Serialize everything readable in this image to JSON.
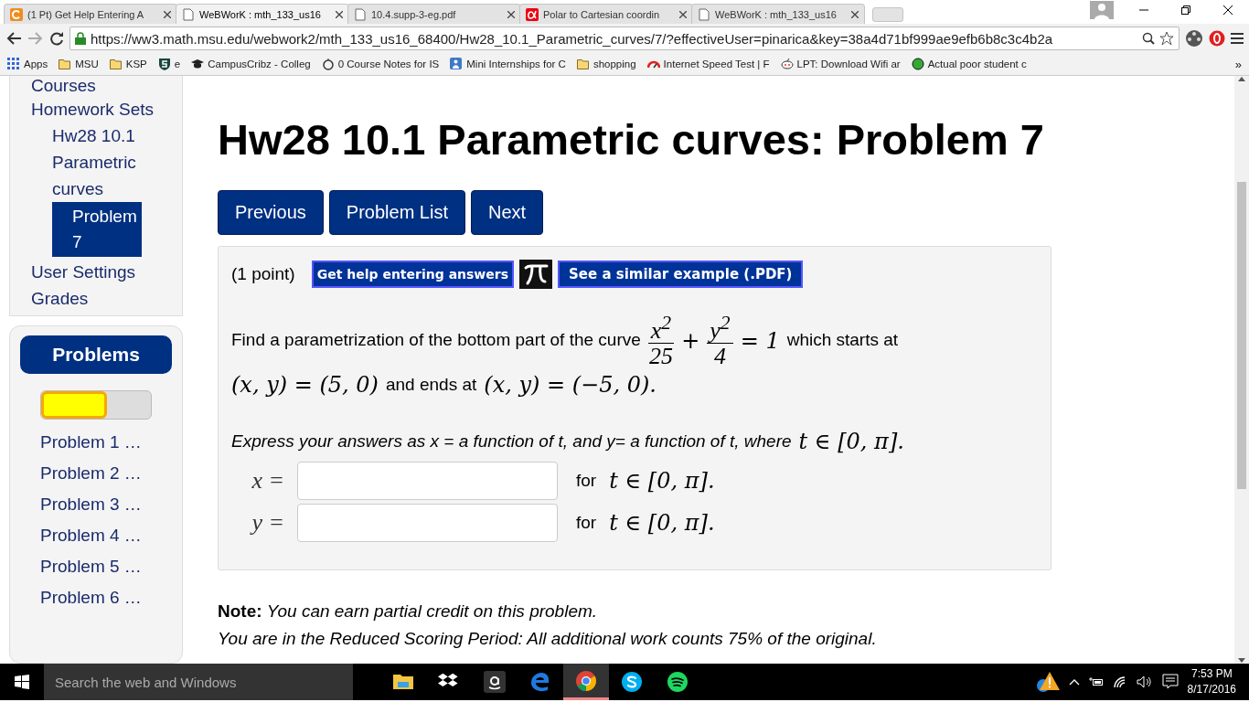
{
  "browser": {
    "tabs": [
      {
        "title": "(1 Pt) Get Help Entering A",
        "selected": false
      },
      {
        "title": "WeBWorK : mth_133_us16",
        "selected": true
      },
      {
        "title": "10.4.supp-3-eg.pdf",
        "selected": false
      },
      {
        "title": "Polar to Cartesian coordin",
        "selected": false
      },
      {
        "title": "WeBWorK : mth_133_us16",
        "selected": false
      }
    ],
    "url": "https://ww3.math.msu.edu/webwork2/mth_133_us16_68400/Hw28_10.1_Parametric_curves/7/?effectiveUser=pinarica&key=38a4d71bf999ae9efb6b8c3c4b2a",
    "bookmarks": [
      {
        "label": "Apps"
      },
      {
        "label": "MSU"
      },
      {
        "label": "KSP"
      },
      {
        "label": "e"
      },
      {
        "label": "CampusCribz - Colleg"
      },
      {
        "label": "0 Course Notes for IS"
      },
      {
        "label": "Mini Internships for C"
      },
      {
        "label": "shopping"
      },
      {
        "label": "Internet Speed Test | F"
      },
      {
        "label": "LPT: Download Wifi ar"
      },
      {
        "label": "Actual poor student c"
      }
    ],
    "more": "»"
  },
  "sidebar": {
    "nav": [
      {
        "label": "Courses"
      },
      {
        "label": "Homework Sets",
        "children": [
          {
            "label": "Hw28 10.1 Parametric curves",
            "selected": false,
            "children": [
              {
                "label": "Problem 7",
                "selected": true
              }
            ]
          }
        ]
      },
      {
        "label": "User Settings"
      },
      {
        "label": "Grades"
      }
    ],
    "problems_title": "Problems",
    "progress": {
      "level": 0.6
    },
    "problems": [
      "Problem 1 …",
      "Problem 2 …",
      "Problem 3 …",
      "Problem 4 …",
      "Problem 5 …",
      "Problem 6 …"
    ]
  },
  "main": {
    "title": "Hw28 10.1 Parametric curves: Problem 7",
    "nav_buttons": [
      "Previous",
      "Problem List",
      "Next"
    ],
    "problem": {
      "points": "(1 point)",
      "help_button": "Get help entering answers",
      "example_button": "See a similar example (.PDF)",
      "statement": [
        {
          "kind": "text",
          "text": "Find a parametrization of the bottom part of the curve"
        },
        {
          "kind": "frac",
          "num": "x$^{2}$",
          "den": "25"
        },
        {
          "kind": "math",
          "text": "+"
        },
        {
          "kind": "frac",
          "num": "y$^{2}$",
          "den": "4"
        },
        {
          "kind": "math",
          "text": "= 1"
        },
        {
          "kind": "text",
          "text": "which starts at"
        },
        {
          "kind": "math",
          "text": "(x, y) = (5, 0)"
        },
        {
          "kind": "text",
          "text": "and ends at"
        },
        {
          "kind": "math",
          "text": "(x, y) = (−5, 0)."
        }
      ],
      "instruction": [
        {
          "kind": "text",
          "text": "Express your answers as  x = a function of t, and  y= a function of t, where"
        },
        {
          "kind": "math",
          "text": "t ∈ [0, π]."
        }
      ],
      "answers": [
        {
          "label": "x =",
          "for": "for",
          "range": "t ∈ [0, π]."
        },
        {
          "label": "y =",
          "for": "for",
          "range": "t ∈ [0, π]."
        }
      ]
    },
    "notes": [
      "**Note:** *You can earn partial credit on this problem.*",
      "You are in the Reduced Scoring Period: All additional work counts 75% of the original."
    ]
  },
  "taskbar": {
    "search_placeholder": "Search the web and Windows",
    "apps": [
      {
        "active": false
      },
      {
        "active": false
      },
      {
        "active": false
      },
      {
        "active": false
      },
      {
        "active": true
      },
      {
        "active": false
      },
      {
        "active": false
      }
    ],
    "time": "7:53 PM",
    "date": "8/17/2016"
  }
}
